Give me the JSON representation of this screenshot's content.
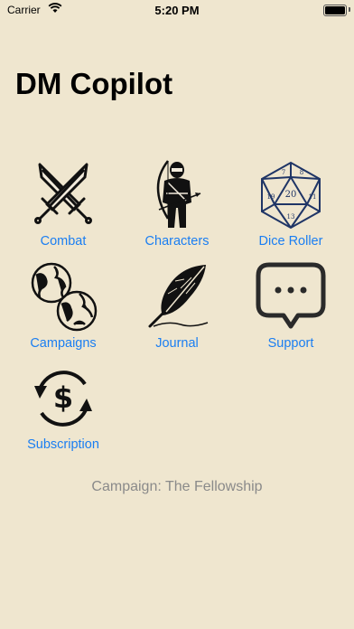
{
  "status_bar": {
    "carrier": "Carrier",
    "time": "5:20 PM"
  },
  "header": {
    "title": "DM Copilot"
  },
  "menu": [
    {
      "label": "Combat",
      "icon": "crossed-swords-icon"
    },
    {
      "label": "Characters",
      "icon": "archer-icon"
    },
    {
      "label": "Dice Roller",
      "icon": "d20-dice-icon"
    },
    {
      "label": "Campaigns",
      "icon": "globes-icon"
    },
    {
      "label": "Journal",
      "icon": "quill-feather-icon"
    },
    {
      "label": "Support",
      "icon": "chat-bubble-icon"
    },
    {
      "label": "Subscription",
      "icon": "dollar-cycle-icon"
    }
  ],
  "footer": {
    "campaign_status": "Campaign: The Fellowship"
  },
  "colors": {
    "background": "#efe6cf",
    "accent": "#1a7ef2",
    "secondary_text": "#8a8a8a"
  }
}
